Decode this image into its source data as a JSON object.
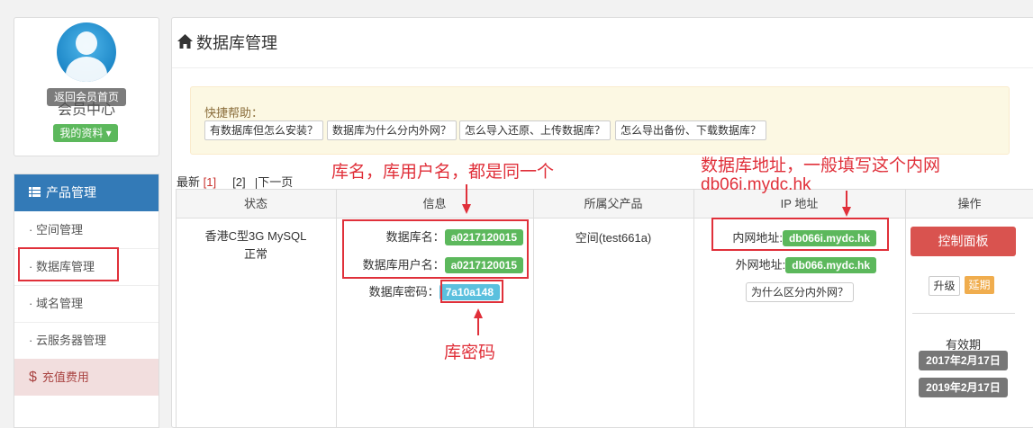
{
  "profile": {
    "tooltip": "返回会员首页",
    "title": "会员中心",
    "my_info": "我的资料 ▾"
  },
  "sidebar": {
    "header_icon": "list-icon",
    "header": "产品管理",
    "items": [
      {
        "label": "· 空间管理"
      },
      {
        "label": "· 数据库管理"
      },
      {
        "label": "· 域名管理"
      },
      {
        "label": "· 云服务器管理"
      }
    ],
    "recharge": "充值费用",
    "recharge_icon": "dollar-icon"
  },
  "main": {
    "title": "数据库管理",
    "title_icon": "home-icon",
    "help": {
      "title": "快捷帮助：",
      "links": [
        "有数据库但怎么安装？",
        "数据库为什么分内外网？",
        "怎么导入还原、上传数据库？",
        "怎么导出备份、下载数据库？"
      ]
    },
    "pager": {
      "first": "最新",
      "p1": "[1]",
      "p2": "[2]",
      "next": "下一页"
    },
    "table": {
      "headers": [
        "状态",
        "信息",
        "所属父产品",
        "IP 地址",
        "操作"
      ],
      "row": {
        "status_line1": "香港C型3G MySQL",
        "status_line2": "正常",
        "db_name_label": "数据库名：",
        "db_name": "a0217120015",
        "db_user_label": "数据库用户名：",
        "db_user": "a0217120015",
        "db_pass_label": "数据库密码：",
        "db_pass": "7a10a148",
        "parent": "空间(test661a)",
        "inner_label": "内网地址:",
        "inner_addr": "db066i.mydc.hk",
        "outer_label": "外网地址:",
        "outer_addr": "db066.mydc.hk",
        "why_btn": "为什么区分内外网？",
        "control_panel": "控制面板",
        "upgrade": "升级",
        "extend": "延期",
        "validity": "有效期",
        "date_start": "2017年2月17日",
        "date_end": "2019年2月17日"
      }
    }
  },
  "annotations": {
    "same_note": "库名，库用户名，都是同一个",
    "addr_note_line1": "数据库地址，一般填写这个内网",
    "addr_note_line2": "db06i.mydc.hk",
    "pass_note": "库密码",
    "color": "#e0303a"
  }
}
